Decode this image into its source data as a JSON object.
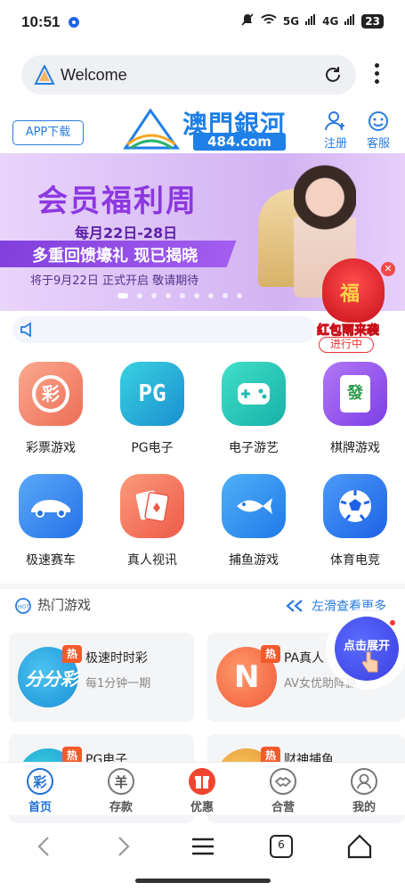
{
  "status_bar": {
    "time": "10:51",
    "net1": "5G",
    "net2": "4G",
    "battery": "23"
  },
  "browser": {
    "page_title": "Welcome",
    "tab_count": "6"
  },
  "header": {
    "app_download": "APP下载",
    "brand_name": "澳門銀河",
    "brand_domain": "484.com",
    "register": "注册",
    "service": "客服"
  },
  "banner": {
    "title": "会员福利周",
    "dates": "每月22日-28日",
    "slogan": "多重回馈壕礼 现已揭晓",
    "subtitle": "将于9月22日 正式开启 敬请期待"
  },
  "red_envelope": {
    "caption": "红包雨来袭",
    "status": "进行中"
  },
  "categories": [
    {
      "label": "彩票游戏",
      "icon": "lottery-icon",
      "color": "#f07a5e"
    },
    {
      "label": "PG电子",
      "icon": "pg-icon",
      "color": "#2fbcd0"
    },
    {
      "label": "电子游艺",
      "icon": "gamepad-icon",
      "color": "#2fd0b8"
    },
    {
      "label": "棋牌游戏",
      "icon": "mahjong-icon",
      "color": "#9a56f0"
    },
    {
      "label": "极速赛车",
      "icon": "race-car-icon",
      "color": "#3a86f0"
    },
    {
      "label": "真人视讯",
      "icon": "cards-icon",
      "color": "#f0705a"
    },
    {
      "label": "捕鱼游戏",
      "icon": "fish-icon",
      "color": "#2b8ef0"
    },
    {
      "label": "体育电竞",
      "icon": "soccer-icon",
      "color": "#2b7af0"
    }
  ],
  "hot_games": {
    "title": "热门游戏",
    "more": "左滑查看更多",
    "items": [
      {
        "name": "极速时时彩",
        "desc": "每1分钟一期",
        "badge": "热"
      },
      {
        "name": "PA真人",
        "desc": "AV女优助阵赢",
        "badge": "热"
      },
      {
        "name": "PG电子",
        "desc": "",
        "badge": "热"
      },
      {
        "name": "财神捕鱼",
        "desc": "",
        "badge": "热"
      }
    ]
  },
  "fab": {
    "label": "点击展开"
  },
  "tabbar": [
    {
      "label": "首页",
      "glyph": "彩"
    },
    {
      "label": "存款",
      "glyph": "羊"
    },
    {
      "label": "优惠",
      "glyph": ""
    },
    {
      "label": "合营",
      "glyph": ""
    },
    {
      "label": "我的",
      "glyph": ""
    }
  ]
}
